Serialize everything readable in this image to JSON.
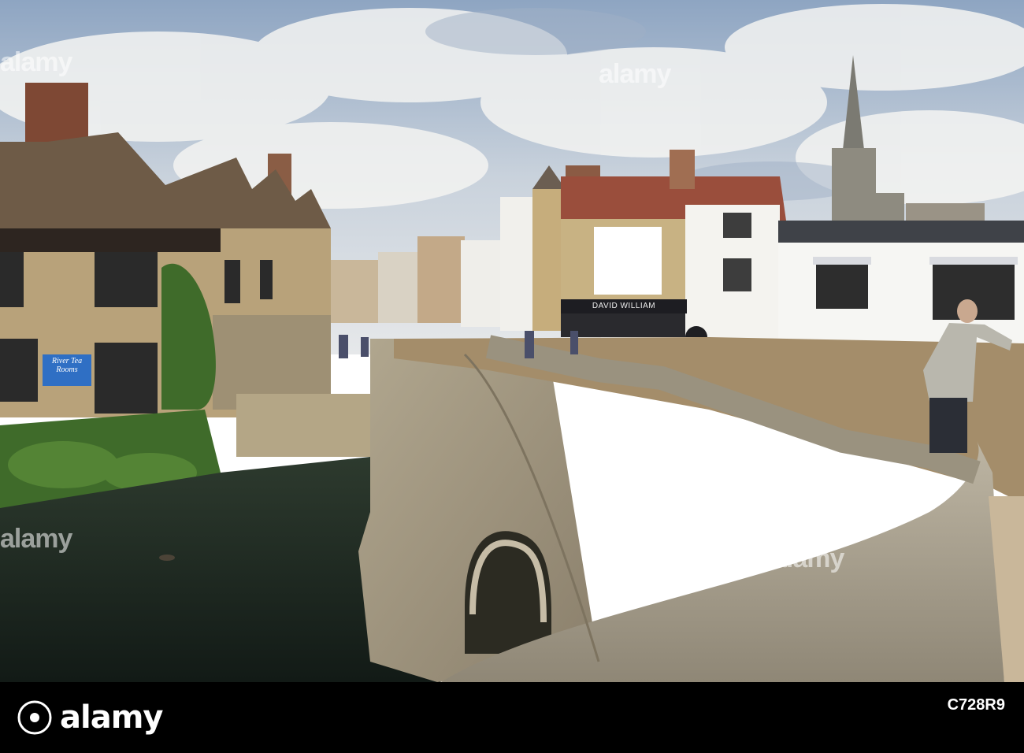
{
  "image": {
    "description_colors": {
      "sky": "#b8c6d6",
      "water": "#1f2a22",
      "stone": "#a59b88",
      "brick": "#b8a27a"
    }
  },
  "photo_text": {
    "sign": "River Tea Rooms",
    "shopfront": "DAVID WILLIAM"
  },
  "watermark": {
    "text": "alamy"
  },
  "footer": {
    "logo_text": "alamy",
    "line1": "",
    "image_id": "C728R9",
    "line3": ""
  }
}
